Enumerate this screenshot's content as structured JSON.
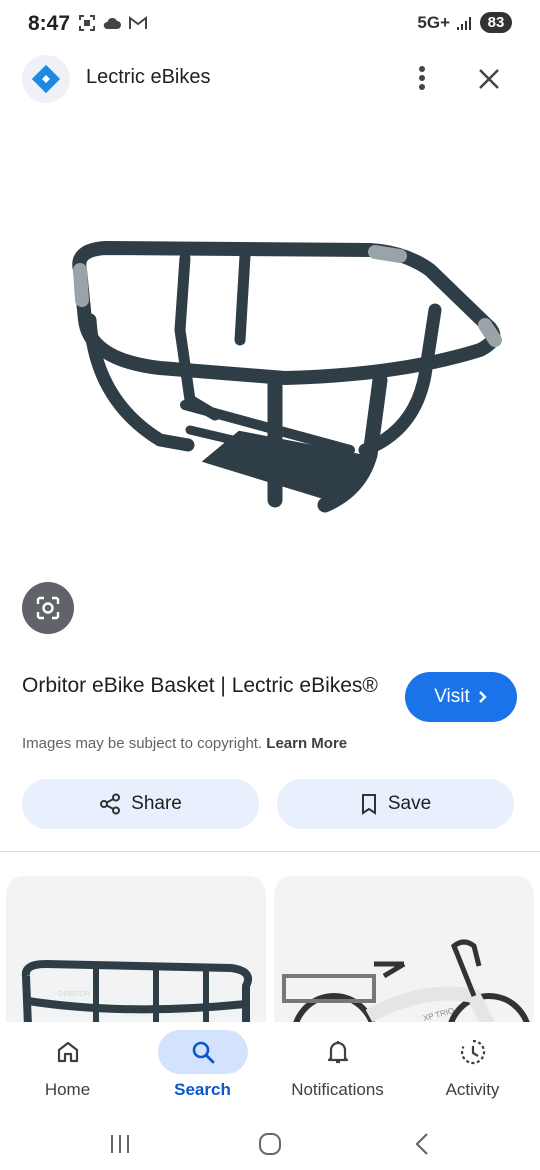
{
  "status_bar": {
    "time": "8:47",
    "network": "5G+",
    "battery": "83",
    "left_icons": [
      "screenshot-icon",
      "cloud-icon",
      "gmail-icon"
    ]
  },
  "header": {
    "site_name": "Lectric eBikes",
    "logo_icon": "diamond-logo-icon"
  },
  "result": {
    "title": "Orbitor eBike Basket | Lectric eBikes®",
    "visit_label": "Visit",
    "copyright_text": "Images may be subject to copyright.",
    "learn_more": "Learn More",
    "share_label": "Share",
    "save_label": "Save"
  },
  "related": [
    {
      "icon": "basket-thumbnail",
      "caption": "ORBITOR"
    },
    {
      "icon": "ebike-thumbnail",
      "caption": "XP TRIO"
    }
  ],
  "bottom_nav": {
    "items": [
      {
        "label": "Home",
        "icon": "home-icon",
        "active": false
      },
      {
        "label": "Search",
        "icon": "search-icon",
        "active": true
      },
      {
        "label": "Notifications",
        "icon": "bell-icon",
        "active": false
      },
      {
        "label": "Activity",
        "icon": "activity-icon",
        "active": false
      }
    ]
  },
  "colors": {
    "accent": "#1a73e8",
    "pill_bg": "#e8f0fe",
    "active_nav": "#d3e3fd",
    "basket": "#2f3e46"
  }
}
